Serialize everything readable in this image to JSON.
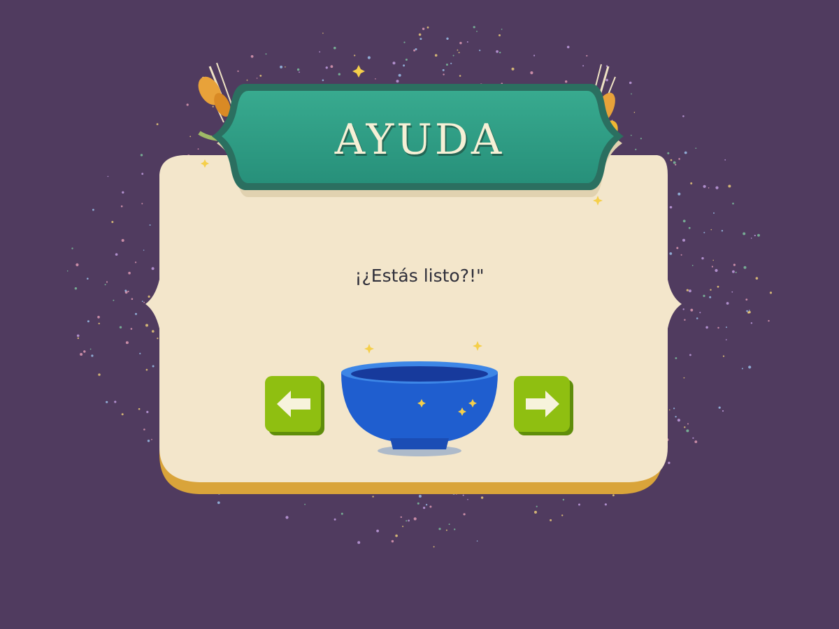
{
  "dialog": {
    "title": "AYUDA",
    "message": "¡¿Estás listo?!\""
  },
  "controls": {
    "prev_icon": "arrow-left-icon",
    "next_icon": "arrow-right-icon"
  },
  "center_item": {
    "icon": "bowl-icon"
  },
  "colors": {
    "background": "#503b5f",
    "panel": "#f3e6cb",
    "panel_edge": "#d9a43a",
    "banner": "#2f9b81",
    "banner_border": "#2b6f60",
    "button": "#8fbf11",
    "button_shadow": "#5f8d0a",
    "bowl": "#2464d6"
  }
}
